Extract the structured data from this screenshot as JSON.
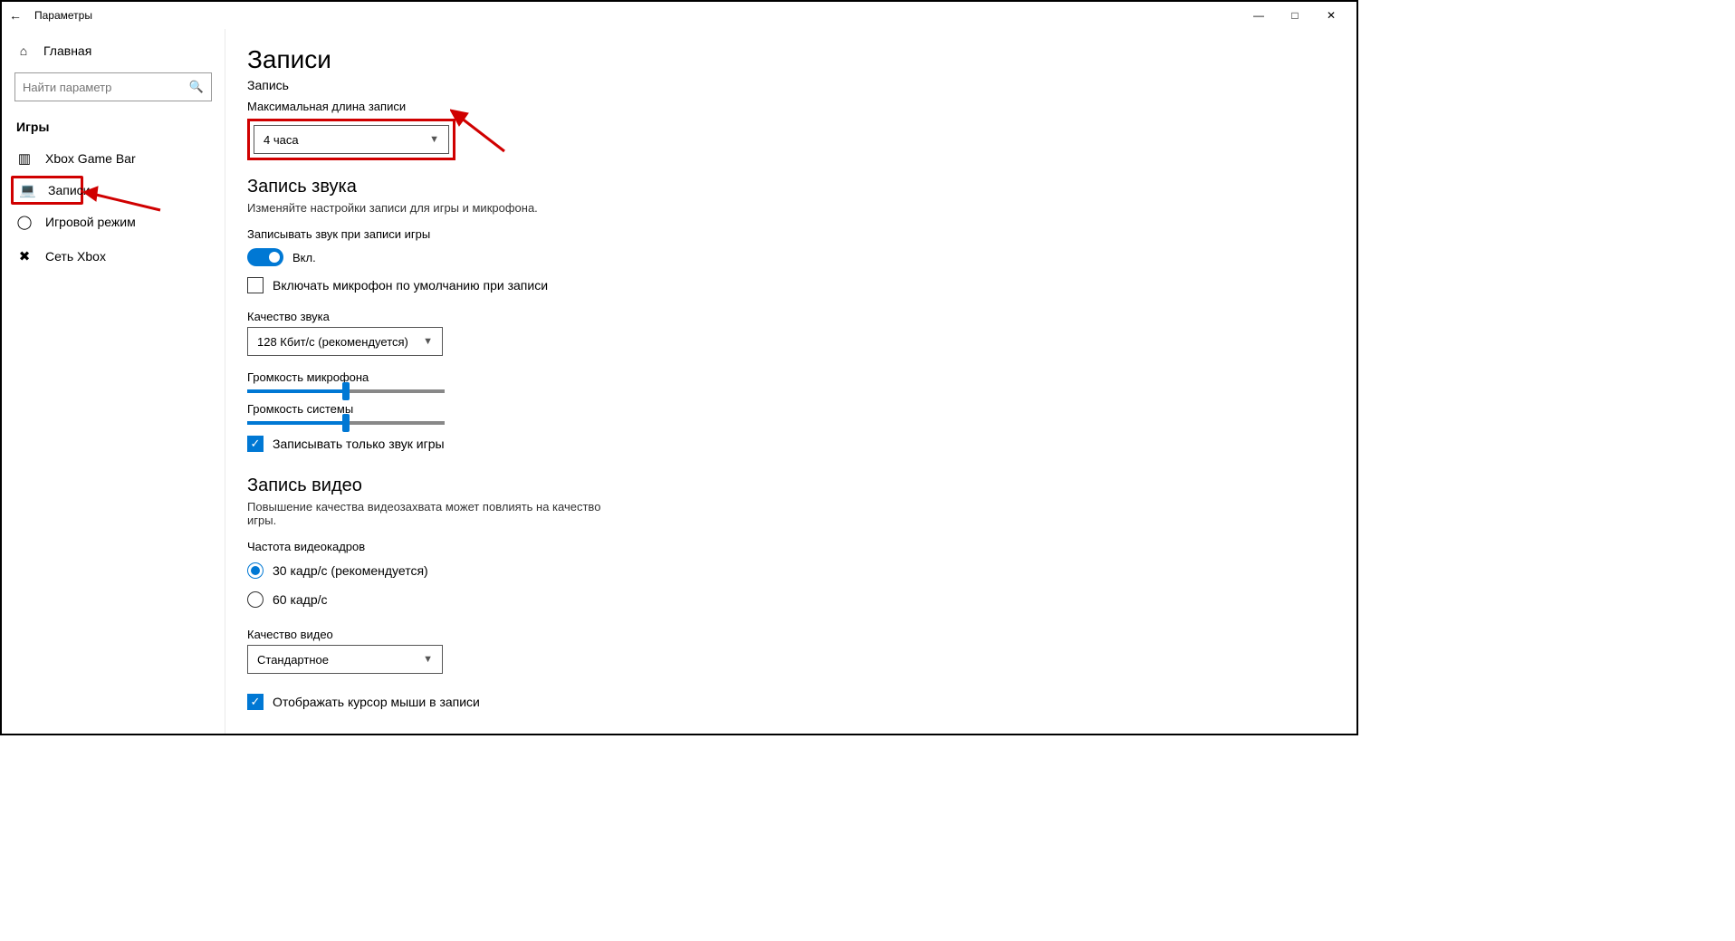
{
  "window": {
    "title": "Параметры"
  },
  "sidebar": {
    "home": "Главная",
    "search_placeholder": "Найти параметр",
    "category": "Игры",
    "items": [
      {
        "icon": "xbox-bar-icon",
        "label": "Xbox Game Bar"
      },
      {
        "icon": "captures-icon",
        "label": "Записи"
      },
      {
        "icon": "game-mode-icon",
        "label": "Игровой режим"
      },
      {
        "icon": "xbox-net-icon",
        "label": "Сеть Xbox"
      }
    ]
  },
  "page": {
    "title": "Записи",
    "rec": {
      "header": "Запись",
      "maxlen_label": "Максимальная длина записи",
      "maxlen_value": "4 часа"
    },
    "audio": {
      "header": "Запись звука",
      "desc": "Изменяйте настройки записи для игры и микрофона.",
      "capture_audio_label": "Записывать звук при записи игры",
      "toggle_on_label": "Вкл.",
      "mic_default_label": "Включать микрофон по умолчанию при записи",
      "quality_label": "Качество звука",
      "quality_value": "128 Кбит/с (рекомендуется)",
      "mic_vol_label": "Громкость микрофона",
      "mic_vol_pct": 50,
      "sys_vol_label": "Громкость системы",
      "sys_vol_pct": 50,
      "game_only_label": "Записывать только звук игры"
    },
    "video": {
      "header": "Запись видео",
      "desc": "Повышение качества видеозахвата может повлиять на качество игры.",
      "fps_label": "Частота видеокадров",
      "fps_options": [
        "30 кадр/с (рекомендуется)",
        "60 кадр/с"
      ],
      "fps_selected": 0,
      "quality_label": "Качество видео",
      "quality_value": "Стандартное",
      "show_cursor_label": "Отображать курсор мыши в записи"
    }
  }
}
